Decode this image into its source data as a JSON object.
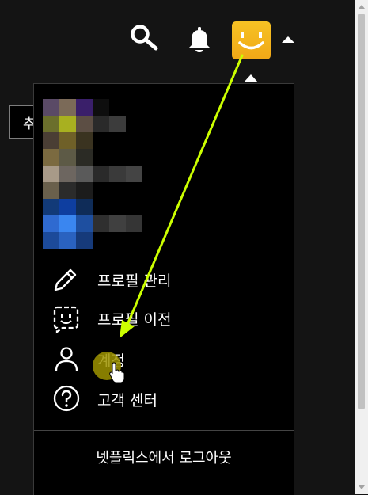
{
  "header": {
    "icons": [
      {
        "name": "search-icon"
      },
      {
        "name": "bell-icon"
      },
      {
        "name": "smiley-avatar-icon"
      },
      {
        "name": "caret-up-icon"
      }
    ]
  },
  "background_field": {
    "leading_char": "추",
    "icon": "lock-icon"
  },
  "profile_menu": {
    "items": [
      {
        "label": "프로필 관리",
        "icon": "pencil-icon"
      },
      {
        "label": "프로필 이전",
        "icon": "profile-transfer-icon"
      },
      {
        "label": "계정",
        "icon": "user-icon"
      },
      {
        "label": "고객 센터",
        "icon": "help-circle-icon"
      }
    ],
    "logout_label": "넷플릭스에서 로그아웃"
  },
  "colors": {
    "background": "#141414",
    "menu_bg": "#000000",
    "avatar": "#f5b81f",
    "annotation_arrow": "#ccff00",
    "click_highlight": "#9d9300"
  }
}
